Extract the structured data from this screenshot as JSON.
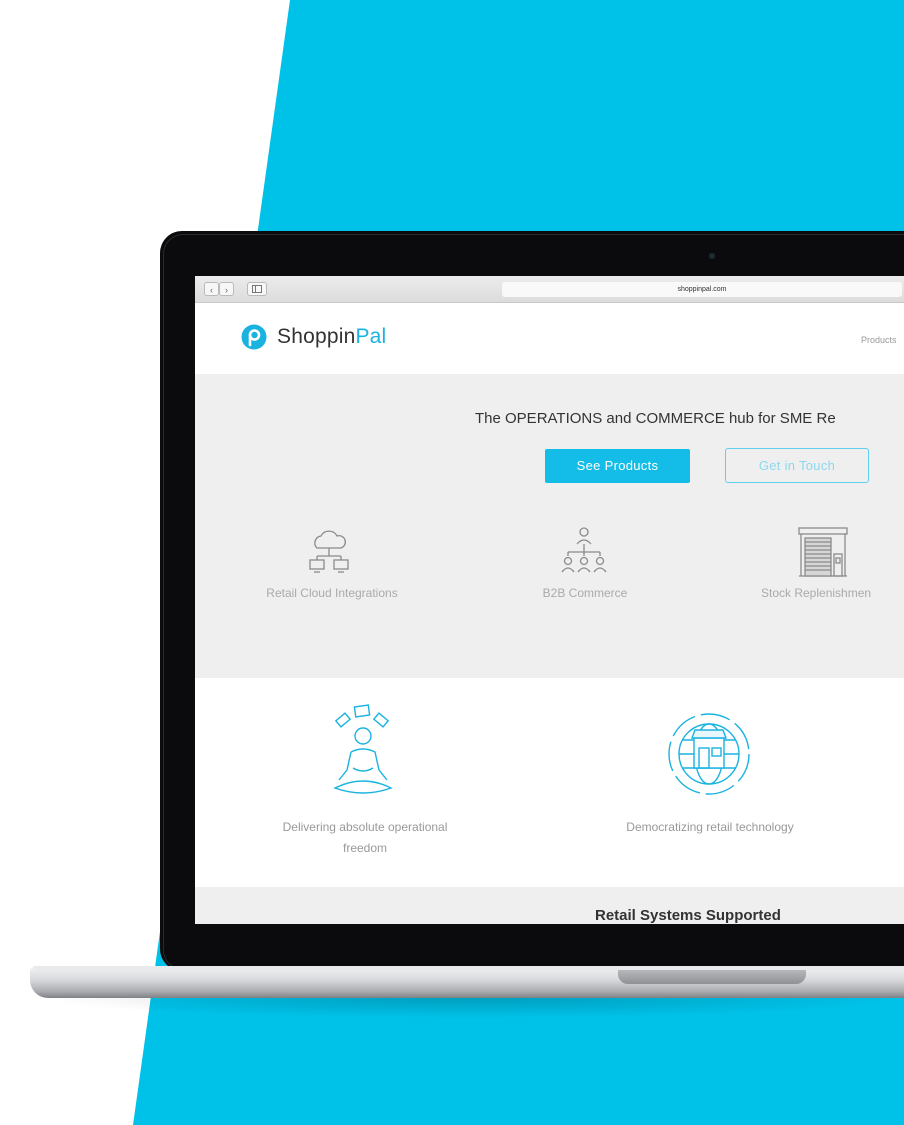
{
  "colors": {
    "brand_cyan": "#00c1e8",
    "button_fill": "#13bde8",
    "hero_bg": "#f0eff0"
  },
  "browser": {
    "url": "shoppinpal.com",
    "back_icon": "chevron-left-icon",
    "forward_icon": "chevron-right-icon",
    "sidebar_icon": "sidebar-icon"
  },
  "header": {
    "logo_part1": "Shoppin",
    "logo_part2": "Pal",
    "nav_products": "Products"
  },
  "hero": {
    "title": "The OPERATIONS and COMMERCE hub for SME Re",
    "primary_button": "See Products",
    "secondary_button": "Get in Touch",
    "features": [
      {
        "label": "Retail Cloud Integrations",
        "icon": "cloud-network-icon"
      },
      {
        "label": "B2B Commerce",
        "icon": "org-chart-icon"
      },
      {
        "label": "Stock Replenishmen",
        "icon": "warehouse-icon"
      }
    ]
  },
  "mission": {
    "items": [
      {
        "line1": "Delivering absolute operational",
        "line2": "freedom",
        "icon": "meditation-icon"
      },
      {
        "line1": "Democratizing retail technology",
        "line2": "",
        "icon": "globe-store-icon"
      }
    ]
  },
  "systems": {
    "title": "Retail Systems Supported"
  }
}
